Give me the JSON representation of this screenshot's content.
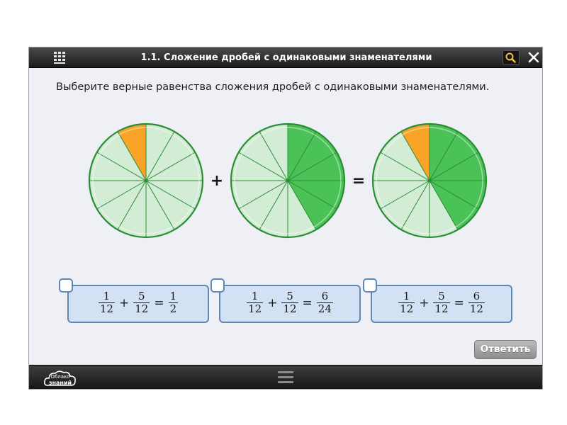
{
  "window": {
    "title": "1.1. Сложение дробей с одинаковыми знаменателями",
    "menu_icon": "grid-menu-icon",
    "search_icon": "search-icon",
    "close_icon": "close-icon"
  },
  "question": "Выберите верные равенства сложения дробей с одинаковыми знаменателями.",
  "diagram": {
    "sectors": 12,
    "plus": "+",
    "equals": "=",
    "colors": {
      "light": "#d3ecd5",
      "green": "#4bc257",
      "orange": "#f9a427",
      "stroke": "#2a8d33"
    },
    "circles": [
      {
        "orange": 1,
        "green": 0
      },
      {
        "orange": 0,
        "green": 5
      },
      {
        "orange": 1,
        "green": 5
      }
    ]
  },
  "options": [
    {
      "a": {
        "num": "1",
        "den": "12"
      },
      "op": "+",
      "b": {
        "num": "5",
        "den": "12"
      },
      "eq": "=",
      "r": {
        "num": "1",
        "den": "2"
      },
      "checked": false
    },
    {
      "a": {
        "num": "1",
        "den": "12"
      },
      "op": "+",
      "b": {
        "num": "5",
        "den": "12"
      },
      "eq": "=",
      "r": {
        "num": "6",
        "den": "24"
      },
      "checked": false
    },
    {
      "a": {
        "num": "1",
        "den": "12"
      },
      "op": "+",
      "b": {
        "num": "5",
        "den": "12"
      },
      "eq": "=",
      "r": {
        "num": "6",
        "den": "12"
      },
      "checked": false
    }
  ],
  "answer_button": "Ответить",
  "footer": {
    "logo_line1": "Облако",
    "logo_line2": "знаний",
    "menu_icon": "hamburger-icon"
  }
}
